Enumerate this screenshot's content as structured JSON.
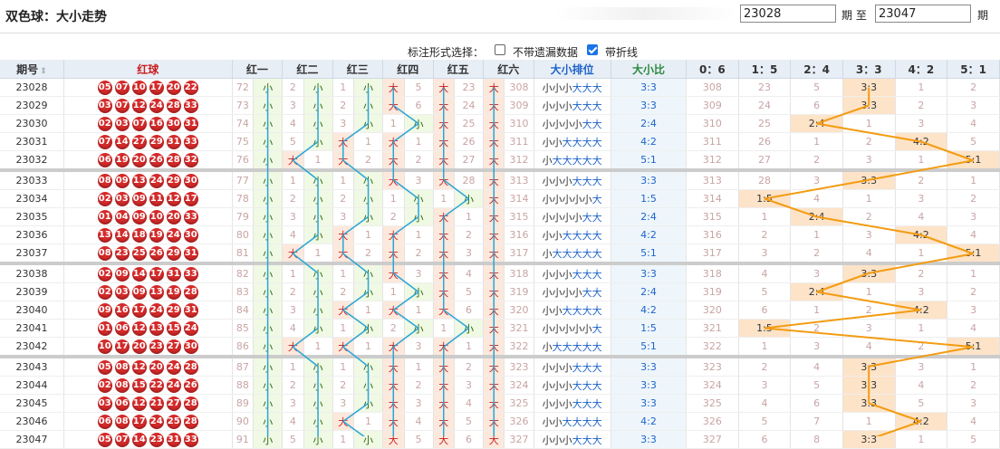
{
  "header": {
    "title": "双色球：大小走势",
    "from_issue": "23028",
    "to_label": "期 至",
    "to_issue": "23047",
    "suffix": "期"
  },
  "options": {
    "label": "标注形式选择：",
    "option1": "不带遗漏数据",
    "option1_checked": false,
    "option2": "带折线",
    "option2_checked": true
  },
  "table": {
    "columns": [
      "期号",
      "红球",
      "红一",
      "红二",
      "红三",
      "红四",
      "红五",
      "红六",
      "大小排位",
      "大小比",
      "0：6",
      "1：5",
      "2：4",
      "3：3",
      "4：2",
      "5：1"
    ],
    "big_label": "大",
    "small_label": "小",
    "rows": [
      {
        "issue": "23028",
        "balls": [
          "05",
          "07",
          "10",
          "17",
          "20",
          "22"
        ],
        "pos": [
          [
            "72",
            "小"
          ],
          [
            "2",
            "小"
          ],
          [
            "1",
            "小"
          ],
          [
            "大",
            "5"
          ],
          [
            "大",
            "23"
          ],
          [
            "大",
            "308"
          ]
        ],
        "dx": [
          "小",
          "小",
          "小",
          "大",
          "大",
          "大"
        ],
        "ratio": "3:3",
        "rc": [
          "308",
          "23",
          "5",
          "3:3",
          "1",
          "2"
        ]
      },
      {
        "issue": "23029",
        "balls": [
          "03",
          "07",
          "12",
          "24",
          "28",
          "33"
        ],
        "pos": [
          [
            "73",
            "小"
          ],
          [
            "3",
            "小"
          ],
          [
            "2",
            "小"
          ],
          [
            "大",
            "6"
          ],
          [
            "大",
            "24"
          ],
          [
            "大",
            "309"
          ]
        ],
        "dx": [
          "小",
          "小",
          "小",
          "大",
          "大",
          "大"
        ],
        "ratio": "3:3",
        "rc": [
          "309",
          "24",
          "6",
          "3:3",
          "2",
          "3"
        ]
      },
      {
        "issue": "23030",
        "balls": [
          "02",
          "03",
          "07",
          "16",
          "30",
          "31"
        ],
        "pos": [
          [
            "74",
            "小"
          ],
          [
            "4",
            "小"
          ],
          [
            "3",
            "小"
          ],
          [
            "1",
            "小"
          ],
          [
            "大",
            "25"
          ],
          [
            "大",
            "310"
          ]
        ],
        "dx": [
          "小",
          "小",
          "小",
          "小",
          "大",
          "大"
        ],
        "ratio": "2:4",
        "rc": [
          "310",
          "25",
          "2:4",
          "1",
          "3",
          "4"
        ]
      },
      {
        "issue": "23031",
        "balls": [
          "07",
          "14",
          "27",
          "29",
          "31",
          "33"
        ],
        "pos": [
          [
            "75",
            "小"
          ],
          [
            "5",
            "小"
          ],
          [
            "大",
            "1"
          ],
          [
            "大",
            "1"
          ],
          [
            "大",
            "26"
          ],
          [
            "大",
            "311"
          ]
        ],
        "dx": [
          "小",
          "小",
          "大",
          "大",
          "大",
          "大"
        ],
        "ratio": "4:2",
        "rc": [
          "311",
          "26",
          "1",
          "2",
          "4:2",
          "5"
        ]
      },
      {
        "issue": "23032",
        "balls": [
          "06",
          "19",
          "20",
          "26",
          "28",
          "32"
        ],
        "pos": [
          [
            "76",
            "小"
          ],
          [
            "大",
            "1"
          ],
          [
            "大",
            "2"
          ],
          [
            "大",
            "2"
          ],
          [
            "大",
            "27"
          ],
          [
            "大",
            "312"
          ]
        ],
        "dx": [
          "小",
          "大",
          "大",
          "大",
          "大",
          "大"
        ],
        "ratio": "5:1",
        "rc": [
          "312",
          "27",
          "2",
          "3",
          "1",
          "5:1"
        ]
      },
      {
        "issue": "23033",
        "balls": [
          "08",
          "09",
          "13",
          "24",
          "29",
          "30"
        ],
        "pos": [
          [
            "77",
            "小"
          ],
          [
            "1",
            "小"
          ],
          [
            "1",
            "小"
          ],
          [
            "大",
            "3"
          ],
          [
            "大",
            "28"
          ],
          [
            "大",
            "313"
          ]
        ],
        "dx": [
          "小",
          "小",
          "小",
          "大",
          "大",
          "大"
        ],
        "ratio": "3:3",
        "rc": [
          "313",
          "28",
          "3",
          "3:3",
          "2",
          "1"
        ]
      },
      {
        "issue": "23034",
        "balls": [
          "02",
          "03",
          "09",
          "11",
          "12",
          "17"
        ],
        "pos": [
          [
            "78",
            "小"
          ],
          [
            "2",
            "小"
          ],
          [
            "2",
            "小"
          ],
          [
            "1",
            "小"
          ],
          [
            "1",
            "小"
          ],
          [
            "大",
            "314"
          ]
        ],
        "dx": [
          "小",
          "小",
          "小",
          "小",
          "小",
          "大"
        ],
        "ratio": "1:5",
        "rc": [
          "314",
          "1:5",
          "4",
          "1",
          "3",
          "2"
        ]
      },
      {
        "issue": "23035",
        "balls": [
          "01",
          "04",
          "09",
          "10",
          "20",
          "33"
        ],
        "pos": [
          [
            "79",
            "小"
          ],
          [
            "3",
            "小"
          ],
          [
            "3",
            "小"
          ],
          [
            "2",
            "小"
          ],
          [
            "大",
            "1"
          ],
          [
            "大",
            "315"
          ]
        ],
        "dx": [
          "小",
          "小",
          "小",
          "小",
          "大",
          "大"
        ],
        "ratio": "2:4",
        "rc": [
          "315",
          "1",
          "2:4",
          "2",
          "4",
          "3"
        ]
      },
      {
        "issue": "23036",
        "balls": [
          "13",
          "14",
          "18",
          "19",
          "24",
          "30"
        ],
        "pos": [
          [
            "80",
            "小"
          ],
          [
            "4",
            "小"
          ],
          [
            "大",
            "1"
          ],
          [
            "大",
            "1"
          ],
          [
            "大",
            "2"
          ],
          [
            "大",
            "316"
          ]
        ],
        "dx": [
          "小",
          "小",
          "大",
          "大",
          "大",
          "大"
        ],
        "ratio": "4:2",
        "rc": [
          "316",
          "2",
          "1",
          "3",
          "4:2",
          "4"
        ]
      },
      {
        "issue": "23037",
        "balls": [
          "08",
          "23",
          "25",
          "26",
          "29",
          "31"
        ],
        "pos": [
          [
            "81",
            "小"
          ],
          [
            "大",
            "1"
          ],
          [
            "大",
            "2"
          ],
          [
            "大",
            "2"
          ],
          [
            "大",
            "3"
          ],
          [
            "大",
            "317"
          ]
        ],
        "dx": [
          "小",
          "大",
          "大",
          "大",
          "大",
          "大"
        ],
        "ratio": "5:1",
        "rc": [
          "317",
          "3",
          "2",
          "4",
          "1",
          "5:1"
        ]
      },
      {
        "issue": "23038",
        "balls": [
          "02",
          "09",
          "14",
          "17",
          "31",
          "33"
        ],
        "pos": [
          [
            "82",
            "小"
          ],
          [
            "1",
            "小"
          ],
          [
            "1",
            "小"
          ],
          [
            "大",
            "3"
          ],
          [
            "大",
            "4"
          ],
          [
            "大",
            "318"
          ]
        ],
        "dx": [
          "小",
          "小",
          "小",
          "大",
          "大",
          "大"
        ],
        "ratio": "3:3",
        "rc": [
          "318",
          "4",
          "3",
          "3:3",
          "2",
          "1"
        ]
      },
      {
        "issue": "23039",
        "balls": [
          "02",
          "03",
          "09",
          "13",
          "19",
          "28"
        ],
        "pos": [
          [
            "83",
            "小"
          ],
          [
            "2",
            "小"
          ],
          [
            "2",
            "小"
          ],
          [
            "1",
            "小"
          ],
          [
            "大",
            "5"
          ],
          [
            "大",
            "319"
          ]
        ],
        "dx": [
          "小",
          "小",
          "小",
          "小",
          "大",
          "大"
        ],
        "ratio": "2:4",
        "rc": [
          "319",
          "5",
          "2:4",
          "1",
          "3",
          "2"
        ]
      },
      {
        "issue": "23040",
        "balls": [
          "09",
          "16",
          "17",
          "24",
          "29",
          "31"
        ],
        "pos": [
          [
            "84",
            "小"
          ],
          [
            "3",
            "小"
          ],
          [
            "大",
            "1"
          ],
          [
            "大",
            "1"
          ],
          [
            "大",
            "6"
          ],
          [
            "大",
            "320"
          ]
        ],
        "dx": [
          "小",
          "小",
          "大",
          "大",
          "大",
          "大"
        ],
        "ratio": "4:2",
        "rc": [
          "320",
          "6",
          "1",
          "2",
          "4:2",
          "3"
        ]
      },
      {
        "issue": "23041",
        "balls": [
          "01",
          "06",
          "12",
          "13",
          "15",
          "24"
        ],
        "pos": [
          [
            "85",
            "小"
          ],
          [
            "4",
            "小"
          ],
          [
            "1",
            "小"
          ],
          [
            "2",
            "小"
          ],
          [
            "1",
            "小"
          ],
          [
            "大",
            "321"
          ]
        ],
        "dx": [
          "小",
          "小",
          "小",
          "小",
          "小",
          "大"
        ],
        "ratio": "1:5",
        "rc": [
          "321",
          "1:5",
          "2",
          "3",
          "1",
          "4"
        ]
      },
      {
        "issue": "23042",
        "balls": [
          "10",
          "17",
          "20",
          "23",
          "27",
          "30"
        ],
        "pos": [
          [
            "86",
            "小"
          ],
          [
            "大",
            "1"
          ],
          [
            "大",
            "1"
          ],
          [
            "大",
            "3"
          ],
          [
            "大",
            "1"
          ],
          [
            "大",
            "322"
          ]
        ],
        "dx": [
          "小",
          "大",
          "大",
          "大",
          "大",
          "大"
        ],
        "ratio": "5:1",
        "rc": [
          "322",
          "1",
          "3",
          "4",
          "2",
          "5:1"
        ]
      },
      {
        "issue": "23043",
        "balls": [
          "05",
          "08",
          "12",
          "20",
          "24",
          "28"
        ],
        "pos": [
          [
            "87",
            "小"
          ],
          [
            "1",
            "小"
          ],
          [
            "1",
            "小"
          ],
          [
            "大",
            "1"
          ],
          [
            "大",
            "2"
          ],
          [
            "大",
            "323"
          ]
        ],
        "dx": [
          "小",
          "小",
          "小",
          "大",
          "大",
          "大"
        ],
        "ratio": "3:3",
        "rc": [
          "323",
          "2",
          "4",
          "3:3",
          "3",
          "1"
        ]
      },
      {
        "issue": "23044",
        "balls": [
          "02",
          "08",
          "15",
          "22",
          "24",
          "26"
        ],
        "pos": [
          [
            "88",
            "小"
          ],
          [
            "2",
            "小"
          ],
          [
            "2",
            "小"
          ],
          [
            "大",
            "2"
          ],
          [
            "大",
            "3"
          ],
          [
            "大",
            "324"
          ]
        ],
        "dx": [
          "小",
          "小",
          "小",
          "大",
          "大",
          "大"
        ],
        "ratio": "3:3",
        "rc": [
          "324",
          "3",
          "5",
          "3:3",
          "4",
          "2"
        ]
      },
      {
        "issue": "23045",
        "balls": [
          "03",
          "06",
          "12",
          "21",
          "27",
          "28"
        ],
        "pos": [
          [
            "89",
            "小"
          ],
          [
            "3",
            "小"
          ],
          [
            "3",
            "小"
          ],
          [
            "大",
            "3"
          ],
          [
            "大",
            "4"
          ],
          [
            "大",
            "325"
          ]
        ],
        "dx": [
          "小",
          "小",
          "小",
          "大",
          "大",
          "大"
        ],
        "ratio": "3:3",
        "rc": [
          "325",
          "4",
          "6",
          "3:3",
          "5",
          "3"
        ]
      },
      {
        "issue": "23046",
        "balls": [
          "06",
          "08",
          "17",
          "24",
          "25",
          "28"
        ],
        "pos": [
          [
            "90",
            "小"
          ],
          [
            "4",
            "小"
          ],
          [
            "大",
            "1"
          ],
          [
            "大",
            "4"
          ],
          [
            "大",
            "5"
          ],
          [
            "大",
            "326"
          ]
        ],
        "dx": [
          "小",
          "小",
          "大",
          "大",
          "大",
          "大"
        ],
        "ratio": "4:2",
        "rc": [
          "326",
          "5",
          "7",
          "1",
          "4:2",
          "4"
        ]
      },
      {
        "issue": "23047",
        "balls": [
          "05",
          "07",
          "14",
          "23",
          "31",
          "33"
        ],
        "pos": [
          [
            "91",
            "小"
          ],
          [
            "5",
            "小"
          ],
          [
            "1",
            "小"
          ],
          [
            "大",
            "5"
          ],
          [
            "大",
            "6"
          ],
          [
            "大",
            "327"
          ]
        ],
        "dx": [
          "小",
          "小",
          "小",
          "大",
          "大",
          "大"
        ],
        "ratio": "3:3",
        "rc": [
          "327",
          "6",
          "8",
          "3:3",
          "1",
          "5"
        ]
      }
    ]
  },
  "colors": {
    "ball": "#d42a2a",
    "big_bg": "#fde8dc",
    "small_bg": "#f0f9e4",
    "ratio_highlight": "#fde3c8",
    "trend_line_red": "#2aa6d6",
    "trend_line_ratio": "#f39c12"
  },
  "icons": {
    "sort": "sort-arrows-icon"
  }
}
